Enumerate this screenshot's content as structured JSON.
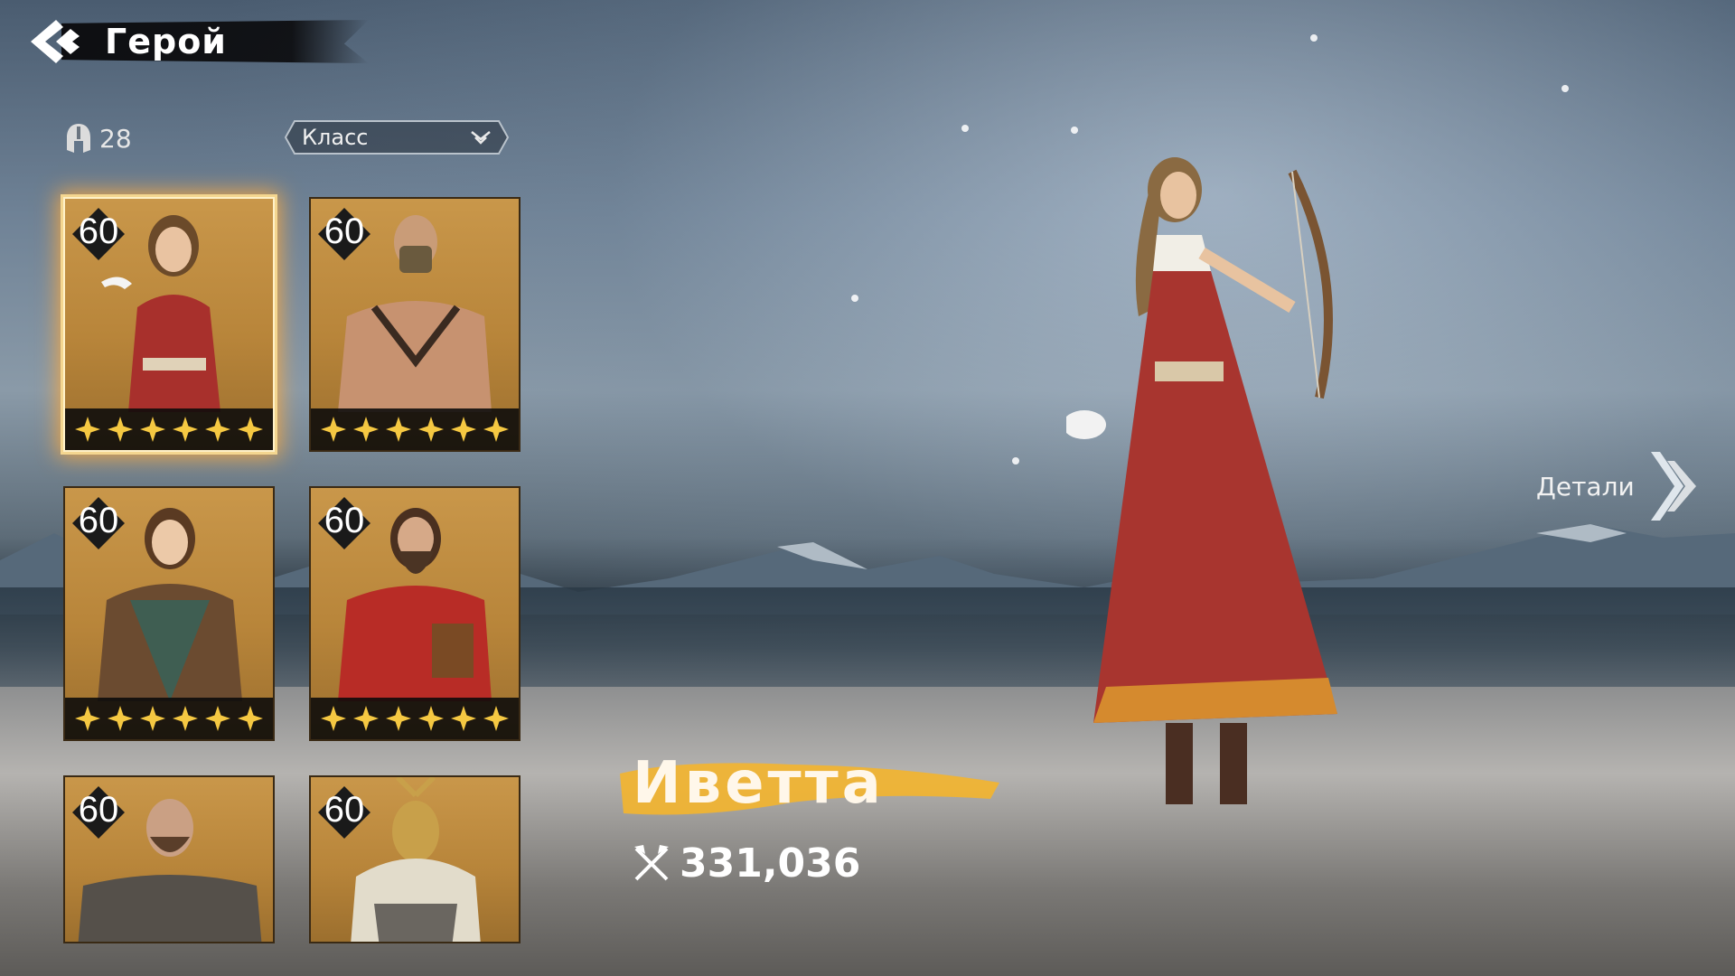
{
  "header": {
    "title": "Герой",
    "back_icon": "back-arrow-icon"
  },
  "roster": {
    "count": "28",
    "count_icon": "helmet-icon"
  },
  "filter": {
    "label": "Класс",
    "icon": "double-chevron-down-icon"
  },
  "heroes": [
    {
      "level": "60",
      "stars": 6,
      "selected": true
    },
    {
      "level": "60",
      "stars": 6,
      "selected": false
    },
    {
      "level": "60",
      "stars": 6,
      "selected": false
    },
    {
      "level": "60",
      "stars": 6,
      "selected": false
    },
    {
      "level": "60",
      "stars": 0,
      "selected": false
    },
    {
      "level": "60",
      "stars": 0,
      "selected": false
    }
  ],
  "selected_hero": {
    "name": "Иветта",
    "power": "331,036",
    "power_icon": "crossed-axes-icon"
  },
  "details": {
    "label": "Детали",
    "icon": "double-chevron-right-icon"
  },
  "colors": {
    "accent_gold": "#f2b430",
    "card_gold": "#c9974a",
    "star": "#f5c842"
  }
}
